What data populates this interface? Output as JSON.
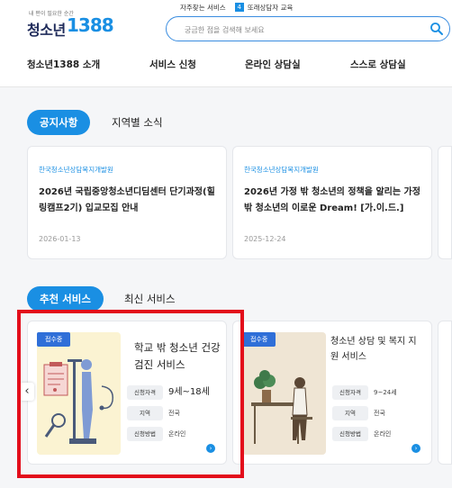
{
  "logo": {
    "tagline": "내 편이 필요한 순간",
    "name": "청소년",
    "number": "1388"
  },
  "top_links": {
    "frequent": "자주찾는 서비스",
    "badge": "4",
    "peer": "또래상담자 교육"
  },
  "search": {
    "placeholder": "궁금한 점을 검색해 보세요"
  },
  "nav": [
    "청소년1388 소개",
    "서비스 신청",
    "온라인 상담실",
    "스스로 상담실"
  ],
  "notice_tabs": [
    {
      "label": "공지사항",
      "active": true
    },
    {
      "label": "지역별 소식",
      "active": false
    }
  ],
  "notices": [
    {
      "org": "한국청소년상담복지개발원",
      "title": "2026년 국립중앙청소년디딤센터 단기과정(힐링캠프2기) 입교모집 안내",
      "date": "2026-01-13"
    },
    {
      "org": "한국청소년상담복지개발원",
      "title": "2026년 가정 밖 청소년의 정책을 알리는 가정 밖 청소년의 이로운 Dream! [가.이.드.]",
      "date": "2025-12-24"
    }
  ],
  "service_tabs": [
    {
      "label": "추천 서비스",
      "active": true
    },
    {
      "label": "최신 서비스",
      "active": false
    }
  ],
  "services": [
    {
      "badge": "접수중",
      "title": "학교 밖 청소년 건강검진 서비스",
      "rows": [
        {
          "key": "신청자격",
          "value": "9세~18세"
        },
        {
          "key": "지역",
          "value": "전국"
        },
        {
          "key": "신청방법",
          "value": "온라인"
        }
      ]
    },
    {
      "badge": "접수중",
      "title": "청소년 상담 및 복지 지원 서비스",
      "rows": [
        {
          "key": "신청자격",
          "value": "9~24세"
        },
        {
          "key": "지역",
          "value": "전국"
        },
        {
          "key": "신청방법",
          "value": "온라인"
        }
      ]
    }
  ],
  "carousel": {
    "prev_glyph": "‹",
    "arrow_glyph": "›"
  },
  "colors": {
    "accent": "#1a8fe3",
    "badge": "#2f6fd8",
    "highlight": "#e30d1b"
  }
}
